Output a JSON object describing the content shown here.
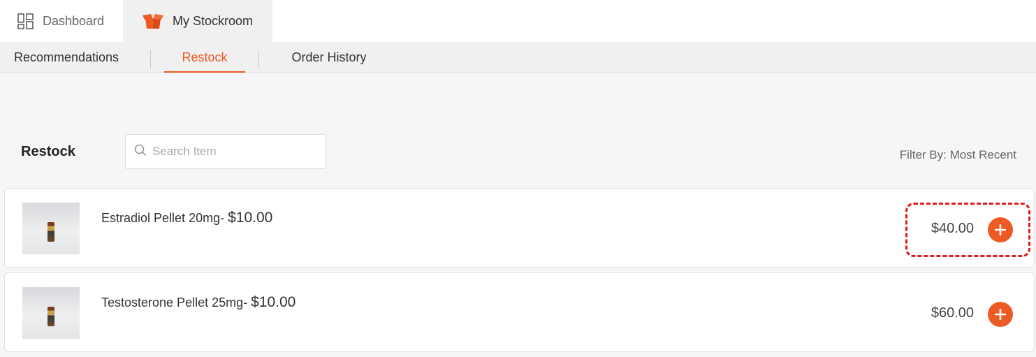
{
  "top_tabs": [
    {
      "label": "Dashboard",
      "icon": "dashboard-grid-icon"
    },
    {
      "label": "My Stockroom",
      "icon": "box-icon",
      "active": true
    }
  ],
  "sub_tabs": [
    {
      "label": "Recommendations"
    },
    {
      "label": "Restock",
      "active": true
    },
    {
      "label": "Order History"
    }
  ],
  "section": {
    "title": "Restock",
    "search_placeholder": "Search Item",
    "filter_label": "Filter By: Most Recent"
  },
  "products": [
    {
      "name": "Estradiol Pellet 20mg-",
      "unit_price": "$10.00",
      "total": "$40.00"
    },
    {
      "name": "Testosterone Pellet 25mg-",
      "unit_price": "$10.00",
      "total": "$60.00"
    }
  ],
  "colors": {
    "accent": "#ee5a24",
    "highlight": "#e01b1b"
  }
}
